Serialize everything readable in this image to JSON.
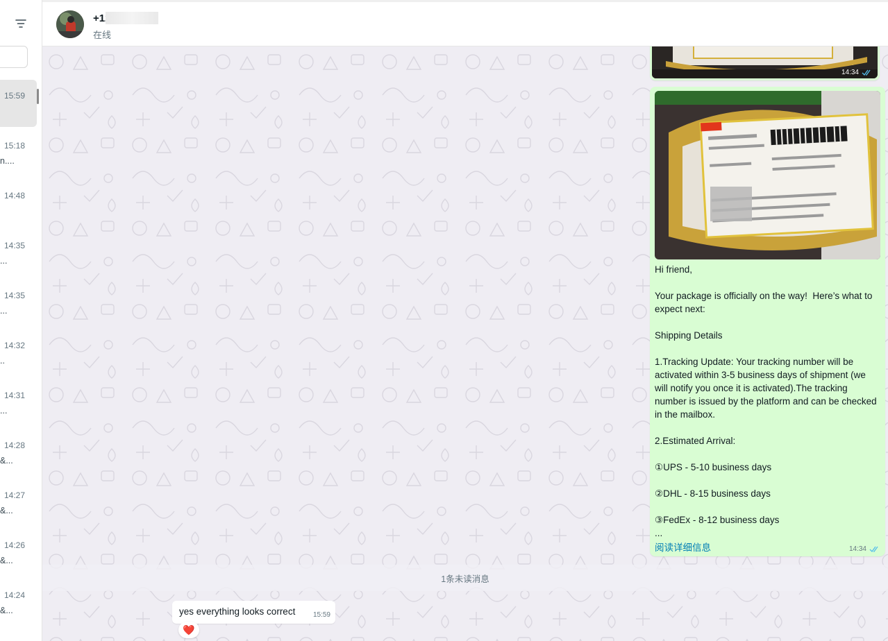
{
  "sidebar": {
    "chats": [
      {
        "time": "15:59",
        "snippet": "",
        "active": true
      },
      {
        "time": "15:18",
        "snippet": "n...."
      },
      {
        "time": "14:48",
        "snippet": ""
      },
      {
        "time": "14:35",
        "snippet": "..."
      },
      {
        "time": "14:35",
        "snippet": "..."
      },
      {
        "time": "14:32",
        "snippet": ".."
      },
      {
        "time": "14:31",
        "snippet": "..."
      },
      {
        "time": "14:28",
        "snippet": "&..."
      },
      {
        "time": "14:27",
        "snippet": "&..."
      },
      {
        "time": "14:26",
        "snippet": "&..."
      },
      {
        "time": "14:24",
        "snippet": "&..."
      }
    ]
  },
  "header": {
    "contact_name": "+12",
    "contact_status": "在线"
  },
  "messages": {
    "image_msg_1": {
      "time": "14:34"
    },
    "text_msg": {
      "time": "14:34",
      "text": "Hi friend,\n\nYour package is officially on the way!  Here’s what to expect next:\n\nShipping Details\n\n1.Tracking Update: Your tracking number will be activated within 3-5 business days of shipment (we will notify you once it is activated).The tracking number is issued by the platform and can be checked in the mailbox.\n\n2.Estimated Arrival:\n\n①UPS - 5-10 business days\n\n②DHL - 8-15 business days\n\n③FedEx - 8-12 business days\n...",
      "read_more": "阅读详细信息"
    },
    "unread_divider": "1条未读消息",
    "incoming": {
      "text": "yes everything looks correct",
      "time": "15:59",
      "reaction": "❤️"
    }
  },
  "colors": {
    "outgoing_bubble": "#d9fdd3",
    "chat_bg": "#efedf3",
    "link": "#027eb5",
    "read_tick": "#53bdeb"
  }
}
